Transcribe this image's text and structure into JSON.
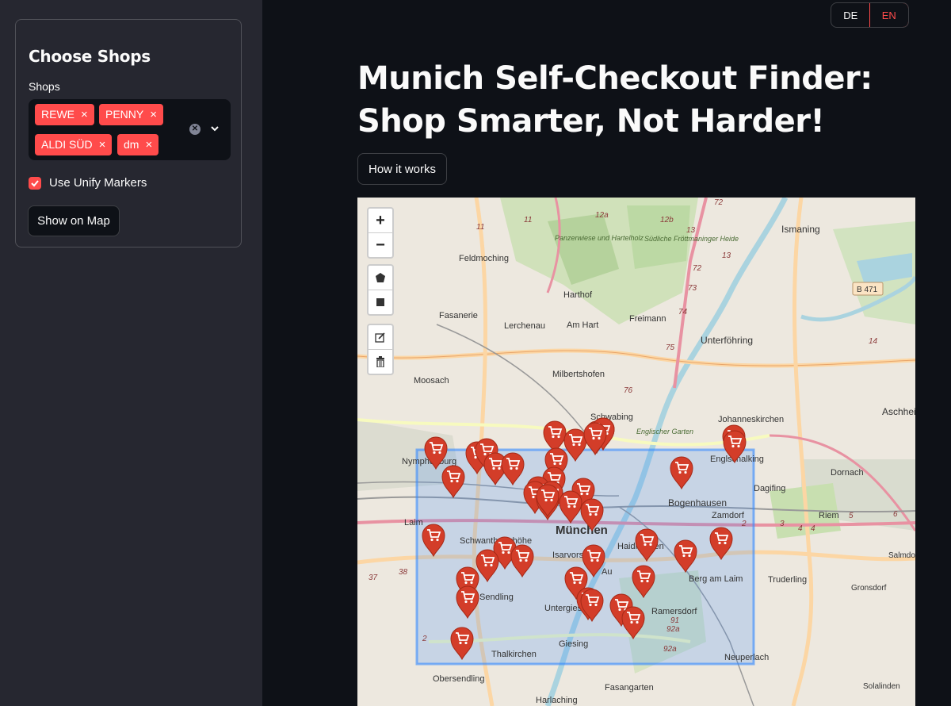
{
  "sidebar": {
    "title": "Choose Shops",
    "shops_label": "Shops",
    "selected_shops": [
      "REWE",
      "PENNY",
      "ALDI SÜD",
      "dm"
    ],
    "unify_label": "Use Unify Markers",
    "unify_checked": true,
    "show_button": "Show on Map"
  },
  "lang": {
    "de": "DE",
    "en": "EN",
    "active": "EN"
  },
  "main": {
    "title": "Munich Self-Checkout Finder: Shop Smarter, Not Harder!",
    "how_button": "How it works"
  },
  "map": {
    "zoom_in": "+",
    "zoom_out": "−",
    "place_labels": [
      "Ismaning",
      "Feldmoching",
      "Panzerwiese und Hartelholz",
      "Südliche Fröttmaninger Heide",
      "Fasanerie",
      "Harthof",
      "Lerchenau",
      "Am Hart",
      "Freimann",
      "Unterföhring",
      "Milbertshofen",
      "Moosach",
      "Schwabing",
      "Englischer Garten",
      "Johanneskirchen",
      "Aschheim",
      "Nymphenburg",
      "Englschalking",
      "Dagifing",
      "Bogenhausen",
      "Dornach",
      "Zamdorf",
      "Riem",
      "Laim",
      "München",
      "Schwanthalerhöhe",
      "Haidhausen",
      "Isarvorstadt",
      "Berg am Laim",
      "Truderling",
      "Salmdorf",
      "Sendling",
      "Au",
      "Untergiesing",
      "Ramersdorf",
      "Gronsdorf",
      "Giesing",
      "Thalkirchen",
      "Neuperlach",
      "Obersendling",
      "Fasangarten",
      "Harlaching",
      "Solalinden",
      "B 471"
    ],
    "road_numbers": [
      "11",
      "12a",
      "12b",
      "13",
      "72",
      "73",
      "74",
      "75",
      "76",
      "14",
      "37",
      "38",
      "91",
      "92a",
      "2",
      "3",
      "4",
      "5",
      "6"
    ],
    "marker_count": 42,
    "marker_icon": "shopping-cart-icon",
    "marker_color": "#d33d29",
    "selection_color": "#3388ff"
  }
}
